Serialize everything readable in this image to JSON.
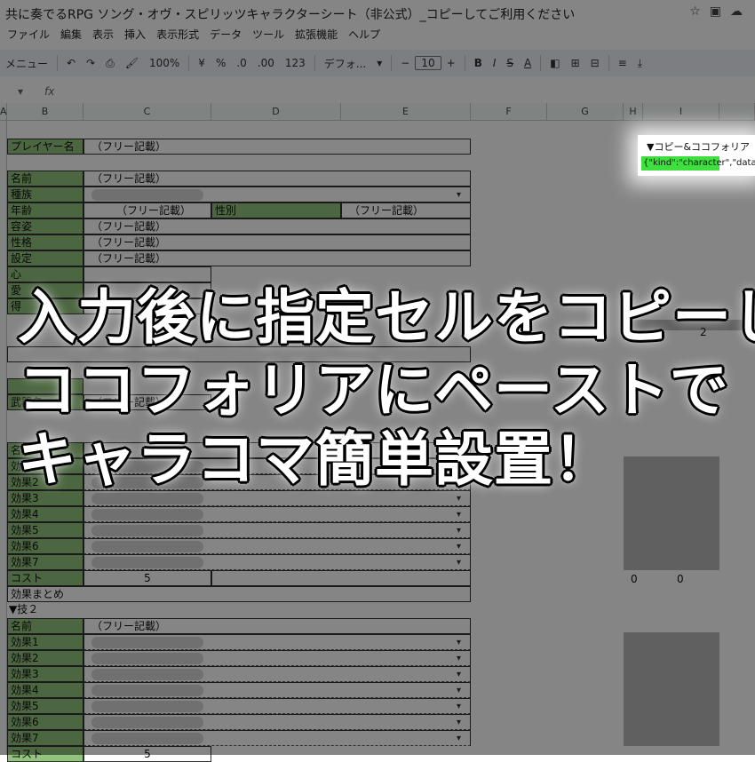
{
  "window": {
    "title": "共に奏でるRPG ソング・オヴ・スピリッツキャラクターシート（非公式）_コピーしてご利用ください",
    "icons": [
      "star-icon",
      "move-folder-icon",
      "cloud-status-icon"
    ]
  },
  "menu": [
    "ファイル",
    "編集",
    "表示",
    "挿入",
    "表示形式",
    "データ",
    "ツール",
    "拡張機能",
    "ヘルプ"
  ],
  "toolbar": {
    "menu_label": "メニュー",
    "zoom": "100%",
    "currency": "¥",
    "percent": "%",
    "dec_decrease": ".0",
    "dec_increase": ".00",
    "number_format": "123",
    "font": "デフォ...",
    "font_size": "10",
    "bold": "B",
    "italic": "I",
    "strike": "S",
    "text_color": "A"
  },
  "formula": {
    "fx": "fx"
  },
  "columns": [
    "A",
    "B",
    "C",
    "D",
    "E",
    "F",
    "G",
    "H",
    "I"
  ],
  "sheet": {
    "player_label": "プレイヤー名",
    "free": "（フリー記載）",
    "name_label": "名前",
    "race_label": "種族",
    "age_label": "年齢",
    "gender_label": "性別",
    "appearance_label": "容姿",
    "personality_label": "性格",
    "setting_label": "設定",
    "kokoro_label": "心",
    "ai_label": "愛",
    "tokui_label": "得",
    "buki_label": "武器名",
    "waza2_header": "▼技２",
    "effects1": [
      "効果1",
      "効果2",
      "効果3",
      "効果4",
      "効果5",
      "効果6",
      "効果7"
    ],
    "effects2": [
      "効果1",
      "効果2",
      "効果3",
      "効果4",
      "効果5",
      "効果6",
      "効果7"
    ],
    "cost_label": "コスト",
    "cost_value": "5",
    "summary_label": "効果まとめ",
    "h_zero": "0",
    "i_zero": "0",
    "i_two": "2"
  },
  "highlight": {
    "title": "▼コピー&ココフォリア",
    "json_snippet": "{\"kind\":\"character\",\"data\""
  },
  "headline": {
    "line1": "入力後に指定セルをコピーし",
    "line2": "ココフォリアにペーストで",
    "line3": "キャラコマ簡単設置！"
  },
  "colors": {
    "label_green": "#93c47d",
    "highlight_green": "#3fdf3f",
    "toolbar_bg": "#eef2f9"
  }
}
